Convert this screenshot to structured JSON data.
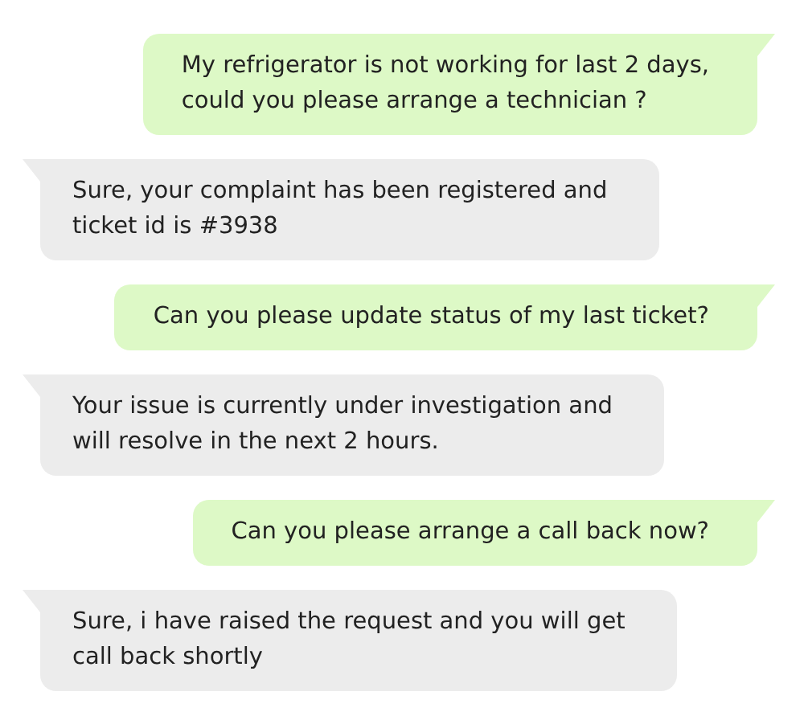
{
  "messages": [
    {
      "kind": "sent",
      "text": "My refrigerator is not working for last 2 days,\ncould you please arrange a technician ?"
    },
    {
      "kind": "received",
      "text": "Sure, your complaint has been registered and\nticket id is #3938"
    },
    {
      "kind": "sent",
      "text": "Can you please update status of my last ticket?"
    },
    {
      "kind": "received",
      "text": "Your issue is currently under investigation and\nwill resolve in the next 2 hours."
    },
    {
      "kind": "sent",
      "text": "Can you please arrange a call back now?"
    },
    {
      "kind": "received",
      "text": "Sure, i have raised the request and you will get\ncall back shortly"
    }
  ]
}
